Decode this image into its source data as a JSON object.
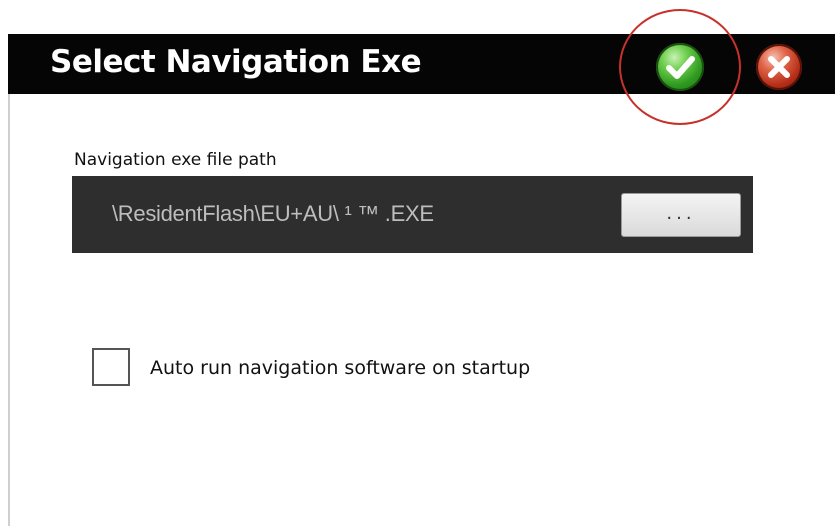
{
  "dialog": {
    "title": "Select Navigation Exe",
    "ok_icon": "checkmark-icon",
    "cancel_icon": "close-icon"
  },
  "path_field": {
    "label": "Navigation exe file path",
    "value": "\\ResidentFlash\\EU+AU\\   ¹  ™   .EXE",
    "browse_label": "..."
  },
  "autorun": {
    "label": "Auto run navigation software on startup",
    "checked": false
  },
  "colors": {
    "titlebar": "#050505",
    "ok_green": "#2f9a20",
    "cancel_red": "#b42d16",
    "highlight_ring": "#c8302a",
    "path_panel": "#2e2e2e"
  }
}
